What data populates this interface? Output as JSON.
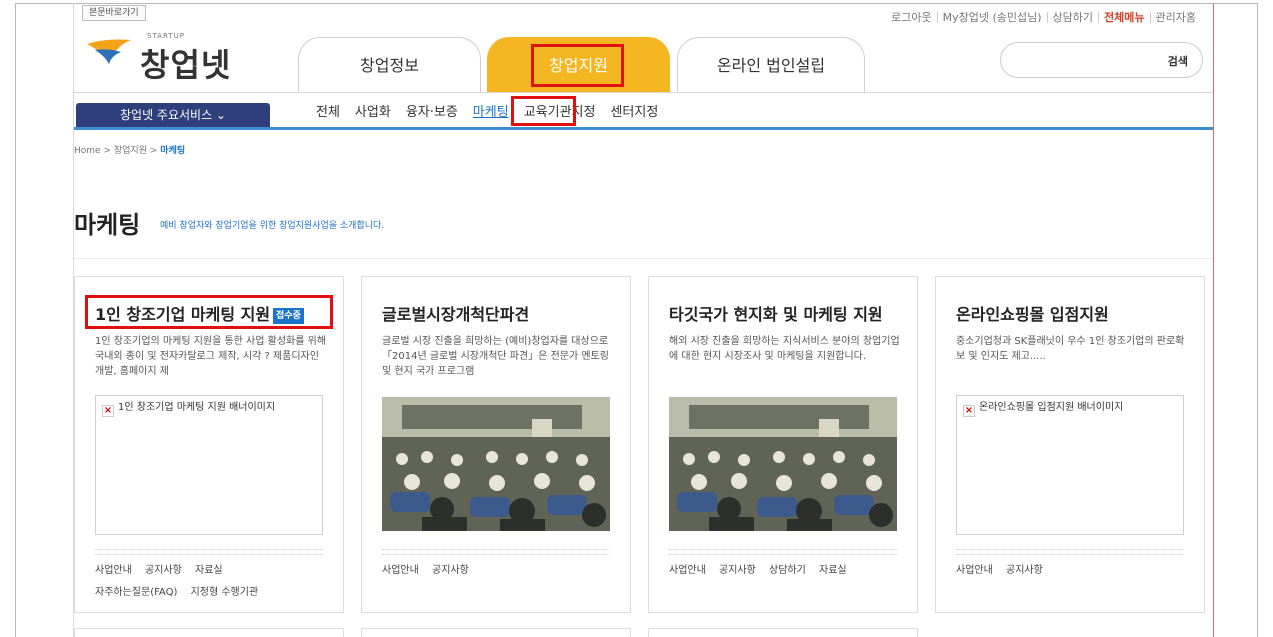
{
  "skip_link": "본문바로가기",
  "util_nav": {
    "items": [
      "로그아웃",
      "My창업넷 (송민섭님)",
      "상담하기",
      "전체메뉴",
      "관리자홈"
    ]
  },
  "logo": {
    "small": "STARTUP",
    "text": "창업넷"
  },
  "gnb": {
    "tabs": [
      "창업정보",
      "창업지원",
      "온라인 법인설립"
    ]
  },
  "search": {
    "button": "검색",
    "placeholder": ""
  },
  "service_menu": "창업넷 주요서비스 ⌄",
  "sub_nav": {
    "items": [
      "전체",
      "사업화",
      "융자·보증",
      "마케팅",
      "교육기관지정",
      "센터지정"
    ]
  },
  "breadcrumb": {
    "home": "Home",
    "level1": "창업지원",
    "current": "마케팅",
    "sep": ">"
  },
  "page": {
    "title": "마케팅",
    "subtitle": "예비 창업자와 창업기업을 위한 창업지원사업을 소개합니다."
  },
  "colors": {
    "accent_yellow": "#f5b721",
    "nav_blue": "#2f3f7c",
    "link_blue": "#1c74c8",
    "annotation_red": "#e01010"
  },
  "cards": [
    {
      "title": "1인 창조기업 마케팅 지원",
      "badge": "접수중",
      "desc": "1인 창조기업의 마케팅 지원을 통한 사업 활성화를 위해 국내외 종이 및 전자카탈로그 제작, 시각 ? 제품디자인 개발, 홈페이지 제",
      "image_alt": "1인 창조기업 마케팅 지원 배너이미지",
      "links": [
        "사업안내",
        "공지사항",
        "자료실",
        "자주하는질문(FAQ)",
        "지정형 수행기관"
      ]
    },
    {
      "title": "글로벌시장개척단파견",
      "badge": "",
      "desc": "글로벌 시장 진출을 희망하는 (예비)창업자를 대상으로 「2014년 글로벌 시장개척단 파견」은 전문가 멘토링 및 현지 국가 프로그램",
      "image_alt": "",
      "links": [
        "사업안내",
        "공지사항"
      ]
    },
    {
      "title": "타깃국가 현지화 및 마케팅 지원",
      "badge": "",
      "desc": "해외 시장 진출을 희망하는 지식서비스 분야의 창업기업에 대한 현지 시장조사 및 마케팅을 지원합니다.",
      "image_alt": "",
      "links": [
        "사업안내",
        "공지사항",
        "상담하기",
        "자료실"
      ]
    },
    {
      "title": "온라인쇼핑몰 입점지원",
      "badge": "",
      "desc": "중소기업청과 SK플래닛이 우수 1인 창조기업의 판로확보 및 인지도 제고.....",
      "image_alt": "온라인쇼핑몰 입점지원 배너이미지",
      "links": [
        "사업안내",
        "공지사항"
      ]
    }
  ]
}
